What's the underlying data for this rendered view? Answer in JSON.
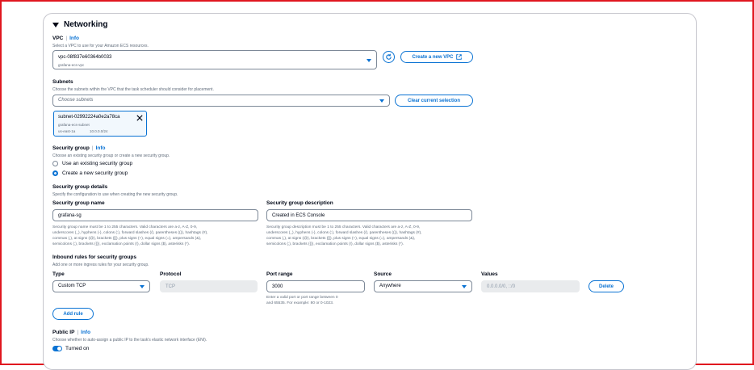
{
  "section": {
    "title": "Networking"
  },
  "vpc": {
    "label": "VPC",
    "info": "Info",
    "description": "Select a VPC to use for your Amazon ECS resources.",
    "value": "vpc-08f837e60364b0033",
    "subvalue": "grafana-ecs-vpc",
    "create_button": "Create a new VPC"
  },
  "subnets": {
    "label": "Subnets",
    "description": "Choose the subnets within the VPC that the task scheduler should consider for placement.",
    "placeholder": "Choose subnets",
    "clear_button": "Clear current selection",
    "token": {
      "id": "subnet-02992224a0e2a78ca",
      "name": "grafana-ecs-subnet",
      "az": "us-east-1a",
      "cidr": "10.0.0.0/24"
    }
  },
  "security_group": {
    "label": "Security group",
    "info": "Info",
    "description": "Choose an existing security group or create a new security group.",
    "options": [
      "Use an existing security group",
      "Create a new security group"
    ],
    "selected": 1
  },
  "sg_details": {
    "label": "Security group details",
    "description": "Specify the configuration to use when creating the new security group.",
    "name_label": "Security group name",
    "name_value": "grafana-sg",
    "name_help_1": "Security group name must be 1 to 255 characters. Valid characters are a-z, A-Z, 0-9,",
    "name_help_2": "underscores (_), hyphens (-), colons (:), forward slashes (/), parentheses (()), hashtags (#),",
    "name_help_3": "commas (,), at signs (@), brackets ([]), plus signs (+), equal signs (=), ampersands (&),",
    "name_help_4": "semicolons (;), brackets ({}), exclamation points (!), dollar signs ($), asterisks (*).",
    "desc_label": "Security group description",
    "desc_value": "Created in ECS Console",
    "desc_help_1": "Security group description must be 1 to 255 characters. Valid characters are a-z, A-Z, 0-9,",
    "desc_help_2": "underscores (_), hyphens (-), colons (:), forward slashes (/), parentheses (()), hashtags (#),",
    "desc_help_3": "commas (,), at signs (@), brackets ([]), plus signs (+), equal signs (=), ampersands (&),",
    "desc_help_4": "semicolons (;), brackets ({}), exclamation points (!), dollar signs ($), asterisks (*)."
  },
  "inbound": {
    "label": "Inbound rules for security groups",
    "description": "Add one or more ingress rules for your security group.",
    "columns": {
      "type": "Type",
      "protocol": "Protocol",
      "port": "Port range",
      "source": "Source",
      "values": "Values"
    },
    "row": {
      "type": "Custom TCP",
      "protocol": "TCP",
      "port": "3000",
      "source": "Anywhere",
      "values_placeholder": "0.0.0.0/0, ::/0",
      "delete": "Delete",
      "port_help_1": "Enter a valid port or port range between 0",
      "port_help_2": "and 65535. For example: 80 or 0-1023."
    },
    "add_rule": "Add rule"
  },
  "public_ip": {
    "label": "Public IP",
    "info": "Info",
    "description": "Choose whether to auto-assign a public IP to the task's elastic network interface (ENI).",
    "state": "Turned on"
  }
}
